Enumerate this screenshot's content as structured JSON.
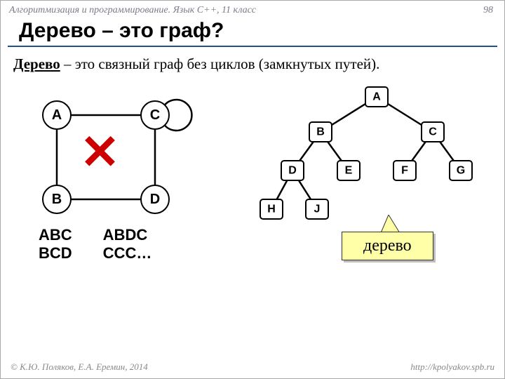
{
  "header": {
    "course": "Алгоритмизация и программирование. Язык C++, 11 класс",
    "page": "98"
  },
  "title": "Дерево – это граф?",
  "subtitle": {
    "bold": "Дерево",
    "rest": " – это связный граф без циклов (замкнутых путей)."
  },
  "graph1": {
    "nodes": {
      "A": "A",
      "B": "B",
      "C": "C",
      "D": "D"
    }
  },
  "tree": {
    "nodes": {
      "A": "A",
      "B": "B",
      "C": "C",
      "D": "D",
      "E": "E",
      "F": "F",
      "G": "G",
      "H": "H",
      "J": "J"
    }
  },
  "paths": {
    "col1_l1": "ABC",
    "col1_l2": "BCD",
    "col2_l1": "ABDС",
    "col2_l2": "CCC…"
  },
  "callout": {
    "label": "дерево"
  },
  "footer": {
    "copyright": "© К.Ю. Поляков, Е.А. Еремин, 2014",
    "url": "http://kpolyakov.spb.ru"
  }
}
